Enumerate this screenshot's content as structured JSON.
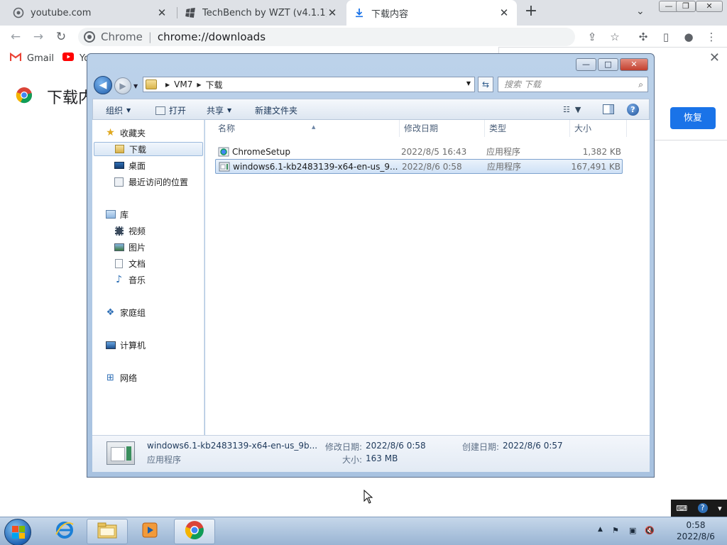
{
  "browser": {
    "tabs": [
      {
        "title": "youtube.com",
        "close": "✕"
      },
      {
        "title": "TechBench by WZT (v4.1.1)",
        "close": "✕"
      },
      {
        "title": "下载内容",
        "close": "✕"
      }
    ],
    "new_tab": "+",
    "tab_search": "⌄",
    "window_controls": {
      "minimize": "—",
      "restore": "❐",
      "close": "✕"
    },
    "nav": {
      "back": "←",
      "forward": "→",
      "reload": "↻"
    },
    "omnibox": {
      "scheme_label": "Chrome",
      "separator": "|",
      "url": "chrome://downloads"
    },
    "toolbar_icons": {
      "share": "⇪",
      "bookmark": "☆",
      "extensions": "✣",
      "sidebar": "▯",
      "profile": "●",
      "menu": "⋮"
    },
    "bookmarks": [
      {
        "label": "Gmail"
      },
      {
        "label": "Yo"
      }
    ]
  },
  "downloads_page": {
    "title": "下载内",
    "restore_panel": {
      "close": "✕",
      "button": "恢复"
    }
  },
  "explorer": {
    "caption": {
      "minimize": "—",
      "maximize": "□",
      "close": "✕"
    },
    "breadcrumb": [
      "VM7",
      "下载"
    ],
    "search_placeholder": "搜索 下载",
    "search_icon": "⌕",
    "commands": {
      "organize": "组织",
      "open": "打开",
      "share": "共享",
      "new_folder": "新建文件夹"
    },
    "help": "?",
    "nav_tree": {
      "favorites": "收藏夹",
      "favorites_items": [
        "下载",
        "桌面",
        "最近访问的位置"
      ],
      "libraries": "库",
      "libraries_items": [
        "视频",
        "图片",
        "文档",
        "音乐"
      ],
      "homegroup": "家庭组",
      "computer": "计算机",
      "network": "网络"
    },
    "columns": {
      "name": "名称",
      "modified": "修改日期",
      "type": "类型",
      "size": "大小"
    },
    "files": [
      {
        "name": "ChromeSetup",
        "modified": "2022/8/5 16:43",
        "type": "应用程序",
        "size": "1,382 KB"
      },
      {
        "name": "windows6.1-kb2483139-x64-en-us_9...",
        "modified": "2022/8/6 0:58",
        "type": "应用程序",
        "size": "167,491 KB"
      }
    ],
    "details": {
      "name": "windows6.1-kb2483139-x64-en-us_9b...",
      "type": "应用程序",
      "modified_label": "修改日期:",
      "modified": "2022/8/6 0:58",
      "size_label": "大小:",
      "size": "163 MB",
      "created_label": "创建日期:",
      "created": "2022/8/6 0:57"
    }
  },
  "taskbar": {
    "clock_time": "0:58",
    "clock_date": "2022/8/6",
    "tray": {
      "show_hidden": "▲",
      "flag": "⚑",
      "network": "▣",
      "volume": "🔇"
    },
    "langbar": {
      "keyboard": "⌨",
      "help": "?",
      "menu": "▾"
    }
  }
}
